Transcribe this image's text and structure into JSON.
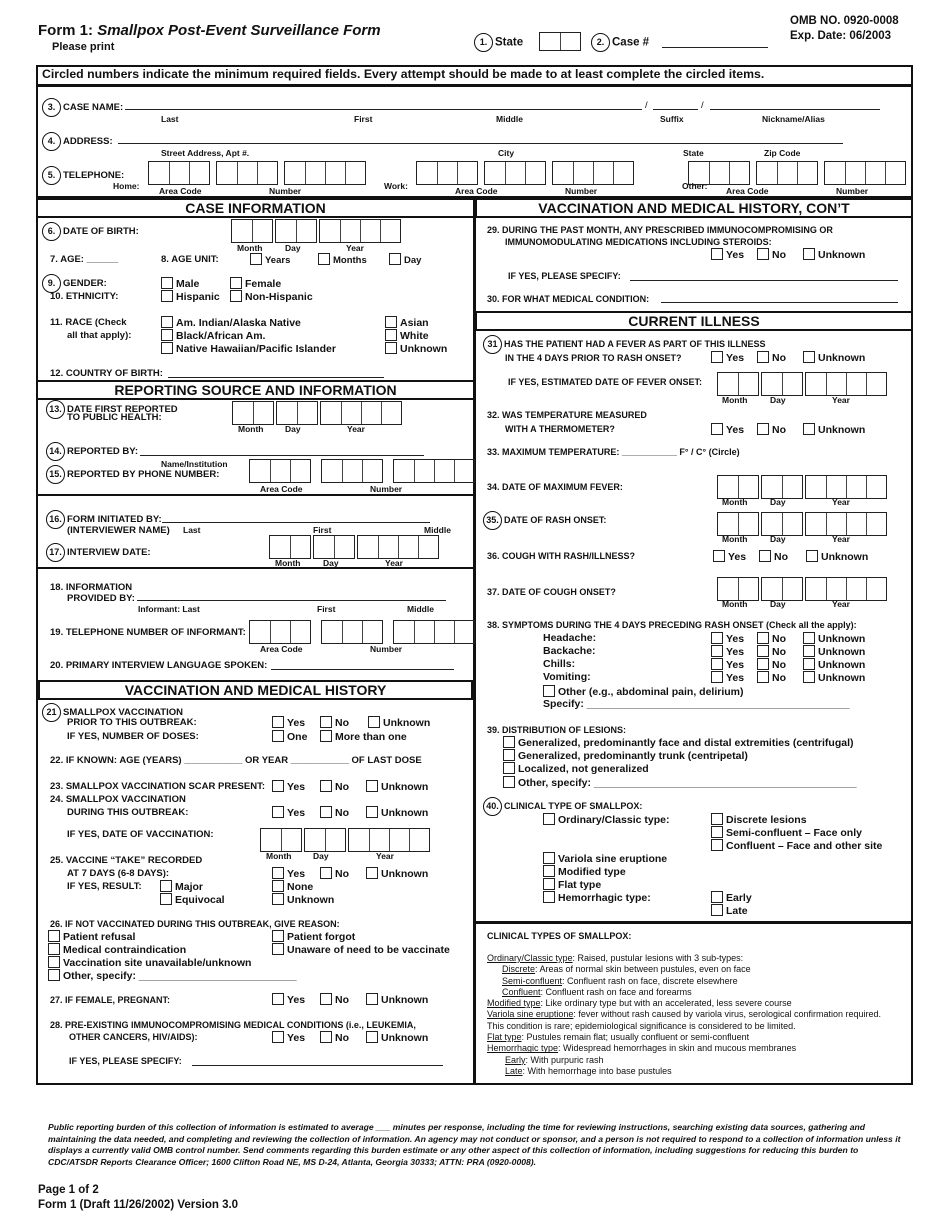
{
  "header": {
    "form_number": "Form 1:",
    "form_title": "Smallpox Post-Event Surveillance Form",
    "please_print": "Please print",
    "state_num": "1.",
    "state_label": "State",
    "case_num": "2.",
    "case_label": "Case #",
    "omb": "OMB NO. 0920-0008",
    "exp": "Exp. Date: 06/2003"
  },
  "instruction": "Circled numbers indicate the minimum required fields.  Every attempt should be made to at least complete the circled items.",
  "identity": {
    "q3_num": "3.",
    "q3_label": "CASE NAME:",
    "q3_subs": [
      "Last",
      "First",
      "Middle",
      "Suffix",
      "Nickname/Alias"
    ],
    "q4_num": "4.",
    "q4_label": "ADDRESS:",
    "q4_subs": [
      "Street Address, Apt #.",
      "City",
      "State",
      "Zip Code"
    ],
    "q5_num": "5.",
    "q5_label": "TELEPHONE:",
    "phone_home": "Home:",
    "phone_work": "Work:",
    "phone_other": "Other:",
    "area_code": "Area Code",
    "number": "Number"
  },
  "date_labels": {
    "month": "Month",
    "day": "Day",
    "year": "Year"
  },
  "yn": {
    "yes": "Yes",
    "no": "No",
    "unknown": "Unknown"
  },
  "sections": {
    "case_info": "CASE INFORMATION",
    "reporting": "REPORTING SOURCE AND INFORMATION",
    "vacc": "VACCINATION AND MEDICAL HISTORY",
    "vacc_cont": "VACCINATION AND MEDICAL HISTORY, CON’T",
    "current": "CURRENT ILLNESS"
  },
  "case_info": {
    "q6_num": "6.",
    "q6": "DATE OF BIRTH:",
    "q7": "7.  AGE: ______",
    "q8": "8.   AGE UNIT:",
    "age_units": [
      "Years",
      "Months",
      "Day"
    ],
    "q9_num": "9.",
    "q9": "GENDER:",
    "gender": [
      "Male",
      "Female"
    ],
    "q10": "10.  ETHNICITY:",
    "ethnicity": [
      "Hispanic",
      "Non-Hispanic"
    ],
    "q11a": "11.  RACE (Check",
    "q11b": "all that apply):",
    "race_left": [
      "Am. Indian/Alaska Native",
      "Black/African Am.",
      "Native Hawaiian/Pacific Islander"
    ],
    "race_right": [
      "Asian",
      "White",
      "Unknown"
    ],
    "q12": "12.  COUNTRY OF BIRTH:"
  },
  "reporting": {
    "q13_num": "13.",
    "q13a": "DATE FIRST REPORTED",
    "q13b": "TO PUBLIC HEALTH:",
    "q14_num": "14.",
    "q14": "REPORTED BY:",
    "q14_sub": "Name/Institution",
    "q15_num": "15.",
    "q15": "REPORTED BY PHONE NUMBER:",
    "q16_num": "16.",
    "q16": "FORM INITIATED BY:",
    "q16b": "(INTERVIEWER NAME)",
    "q16_subs": [
      "Last",
      "First",
      "Middle"
    ],
    "q17_num": "17.",
    "q17": "INTERVIEW DATE:",
    "q18a": "18.  INFORMATION",
    "q18b": "PROVIDED BY:",
    "q18_subs": [
      "Informant: Last",
      "First",
      "Middle"
    ],
    "q19": "19.  TELEPHONE NUMBER OF INFORMANT:",
    "q20": "20.  PRIMARY INTERVIEW LANGUAGE SPOKEN:"
  },
  "vacc": {
    "q21_num": "21",
    "q21a": "SMALLPOX VACCINATION",
    "q21b": "PRIOR TO THIS OUTBREAK:",
    "q21c": "IF YES, NUMBER OF DOSES:",
    "doses": [
      "One",
      "More than one"
    ],
    "q22": "22.  IF KNOWN:    AGE (YEARS) ___________       OR YEAR ___________ OF LAST DOSE",
    "q23": "23.  SMALLPOX VACCINATION SCAR PRESENT:",
    "q24a": "24.  SMALLPOX VACCINATION",
    "q24b": "DURING THIS OUTBREAK:",
    "q24c": "IF YES, DATE OF VACCINATION:",
    "q25a": "25.  VACCINE “TAKE” RECORDED",
    "q25b": "AT 7 DAYS (6-8 DAYS):",
    "q25c": "IF YES, RESULT:",
    "result_left": [
      "Major",
      "Equivocal"
    ],
    "result_right": [
      "None",
      "Unknown"
    ],
    "q26": "26.  IF NOT VACCINATED DURING THIS OUTBREAK, GIVE REASON:",
    "reasons_left": [
      "Patient refusal",
      "Medical contraindication",
      "Vaccination site unavailable/unknown",
      "Other, specify: ___________________________"
    ],
    "reasons_right": [
      "Patient forgot",
      "Unaware of need to be vaccinate"
    ],
    "q27": "27.  IF FEMALE, PREGNANT:",
    "q28a": "28.  PRE-EXISTING IMMUNOCOMPROMISING MEDICAL CONDITIONS (i.e., LEUKEMIA,",
    "q28b": "OTHER CANCERS, HIV/AIDS):",
    "q28c": "IF YES, PLEASE SPECIFY:"
  },
  "vacc_cont": {
    "q29a": "29.  DURING THE PAST MONTH, ANY PRESCRIBED IMMUNOCOMPROMISING OR",
    "q29b": "IMMUNOMODULATING MEDICATIONS INCLUDING STEROIDS:",
    "q29c": "IF YES, PLEASE SPECIFY:",
    "q30": "30.  FOR WHAT MEDICAL CONDITION:"
  },
  "current": {
    "q31_num": "31",
    "q31a": "HAS THE PATIENT HAD A FEVER AS PART OF THIS ILLNESS",
    "q31b": "IN THE 4 DAYS PRIOR TO RASH ONSET?",
    "q31c": "IF YES, ESTIMATED DATE OF FEVER ONSET:",
    "q32a": "32.  WAS TEMPERATURE MEASURED",
    "q32b": "WITH A THERMOMETER?",
    "q33": "33.  MAXIMUM TEMPERATURE:  ___________  F°  /  C°   (Circle)",
    "q34": "34.  DATE OF MAXIMUM FEVER:",
    "q35_num": "35.",
    "q35": "DATE OF RASH ONSET:",
    "q36": "36.  COUGH WITH RASH/ILLNESS?",
    "q37": "37. DATE OF COUGH ONSET?",
    "q38": "38.  SYMPTOMS DURING THE 4 DAYS PRECEDING RASH ONSET (Check all the apply):",
    "symptoms": [
      "Headache:",
      "Backache:",
      "Chills:",
      "Vomiting:"
    ],
    "other_symptom": "Other (e.g., abdominal pain, delirium)",
    "specify": "Specify: _____________________________________________",
    "q39": "39.  DISTRIBUTION OF LESIONS:",
    "lesions": [
      "Generalized, predominantly face and distal extremities (centrifugal)",
      "Generalized, predominantly trunk (centripetal)",
      "Localized, not generalized",
      "Other, specify: _____________________________________________"
    ],
    "q40_num": "40.",
    "q40": "CLINICAL TYPE OF SMALLPOX:",
    "types_left": [
      "Ordinary/Classic type:",
      "Variola sine eruptione",
      "Modified type",
      "Flat type",
      "Hemorrhagic type:"
    ],
    "ordinary_sub": [
      "Discrete lesions",
      "Semi-confluent – Face only",
      "Confluent – Face and other site"
    ],
    "hemorrhagic_sub": [
      "Early",
      "Late"
    ]
  },
  "definitions": {
    "title": "CLINICAL TYPES OF SMALLPOX:",
    "items": [
      {
        "term": "Ordinary/Classic type",
        "text": ":  Raised, pustular lesions with 3 sub-types:",
        "indent": 0
      },
      {
        "term": "Discrete",
        "text": ":  Areas of normal skin between pustules, even on face",
        "indent": 1
      },
      {
        "term": "Semi-confluent",
        "text": ":  Confluent rash on face, discrete elsewhere",
        "indent": 1
      },
      {
        "term": "Confluent",
        "text": ":  Confluent rash on face and forearms",
        "indent": 1
      },
      {
        "term": "Modified type",
        "text": ":  Like ordinary type but with an accelerated, less severe course",
        "indent": 0
      },
      {
        "term": "Variola sine eruptione",
        "text": ": fever without rash caused by variola virus, serological confirmation required.",
        "indent": 0
      },
      {
        "term": "",
        "text": "This condition is rare; epidemiological significance is considered to be limited.",
        "indent": 0
      },
      {
        "term": "Flat type",
        "text": ":  Pustules remain flat; usually confluent or semi-confluent",
        "indent": 0
      },
      {
        "term": "Hemorrhagic type",
        "text": ":  Widespread hemorrhages in skin and mucous membranes",
        "indent": 0
      },
      {
        "term": "Early",
        "text": ":  With purpuric rash",
        "indent": 2
      },
      {
        "term": "Late",
        "text": ":  With hemorrhage into base pustules",
        "indent": 2
      }
    ]
  },
  "footer": {
    "burden": "Public reporting burden of this collection of information is estimated to average ___ minutes per response, including the time for reviewing instructions, searching existing data sources, gathering and maintaining the data needed, and completing and reviewing the collection of information. An agency may not conduct or sponsor, and a person is not required to respond to a collection of information unless it displays a currently valid OMB control number. Send comments regarding this burden estimate or any other aspect of this collection of information, including suggestions for reducing this burden to CDC/ATSDR Reports Clearance Officer; 1600 Clifton Road NE, MS D-24, Atlanta, Georgia 30333; ATTN: PRA (0920-0008).",
    "page": "Page 1 of 2",
    "version": "Form 1 (Draft 11/26/2002) Version 3.0"
  }
}
